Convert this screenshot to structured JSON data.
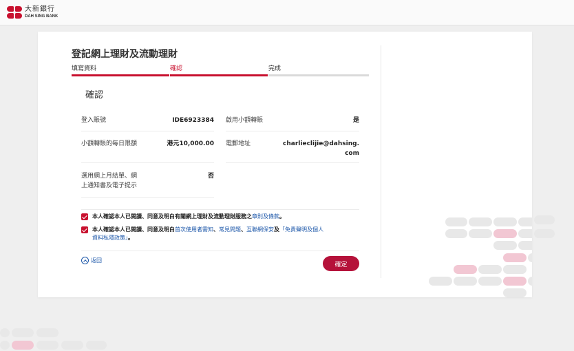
{
  "header": {
    "logo_zh": "大新銀行",
    "logo_en": "DAH SING BANK"
  },
  "page": {
    "title": "登記網上理財及流動理財",
    "steps": [
      {
        "label": "填寫資料",
        "state": "done"
      },
      {
        "label": "確認",
        "state": "active"
      },
      {
        "label": "完成",
        "state": "todo"
      }
    ],
    "section_title": "確認"
  },
  "fields": {
    "login_account": {
      "label": "登入賬號",
      "value": "IDE6923384"
    },
    "small_transfer": {
      "label": "啟用小額轉賬",
      "value": "是"
    },
    "daily_limit": {
      "label": "小額轉賬的每日限額",
      "value": "港元10,000.00"
    },
    "email": {
      "label": "電郵地址",
      "value_line1": "charlieclijie@dahsing.",
      "value_line2": "com"
    },
    "estatement": {
      "label_line1": "選用網上月結單、網",
      "label_line2": "上通知書及電子提示",
      "value": "否"
    }
  },
  "agreements": [
    {
      "checked": true,
      "text_before": "本人確認本人已閱讀、同意及明白有關網上理財及流動理財服務之",
      "link": "章則及條款",
      "text_after": "。"
    },
    {
      "checked": true,
      "text_before": "本人確認本人已閱讀、同意及明白",
      "link1": "首次使用者需知",
      "sep1": "、",
      "link2": "常見問題",
      "sep2": "、",
      "link3": "互聯網保安",
      "sep3": "及",
      "link4": "「免責聲明及個人",
      "link4b": "資料私隱政策」",
      "text_after": "。"
    }
  ],
  "actions": {
    "back_label": "返回",
    "confirm_label": "確定"
  },
  "colors": {
    "brand": "#c8102e",
    "button": "#b5123a",
    "link": "#1a55a8",
    "pill_grey": "#e8e8e8",
    "pill_pink": "#f2c7d3"
  }
}
